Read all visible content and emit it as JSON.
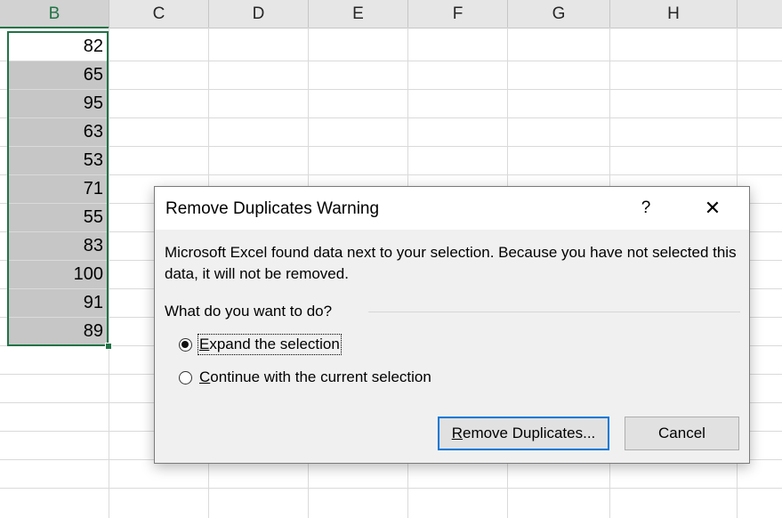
{
  "sheet": {
    "columns": [
      "B",
      "C",
      "D",
      "E",
      "F",
      "G",
      "H"
    ],
    "selected_column": "B",
    "column_b_values": [
      "82",
      "65",
      "95",
      "63",
      "53",
      "71",
      "55",
      "83",
      "100",
      "91",
      "89"
    ],
    "selection_color": "#217346"
  },
  "dialog": {
    "title": "Remove Duplicates Warning",
    "help_label": "?",
    "close_label": "✕",
    "message": "Microsoft Excel found data next to your selection. Because you have not selected this data, it will not be removed.",
    "question": "What do you want to do?",
    "options": [
      {
        "accel": "E",
        "rest": "xpand the selection",
        "checked": true
      },
      {
        "accel": "C",
        "rest": "ontinue with the current selection",
        "checked": false
      }
    ],
    "primary_button": {
      "accel": "R",
      "rest": "emove Duplicates..."
    },
    "cancel_button": "Cancel"
  }
}
